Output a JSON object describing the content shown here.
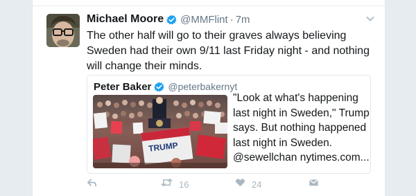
{
  "tweet": {
    "author_name": "Michael Moore",
    "author_handle": "@MMFlint",
    "separator": "·",
    "time": "7m",
    "text": "The other half will go to their graves always believing Sweden had their own 9/11 last Friday night - and nothing will change their minds."
  },
  "quote": {
    "author_name": "Peter Baker",
    "author_handle": "@peterbakernyt",
    "text_lines": [
      "\"Look at what's happening",
      "last night in Sweden,\" Trump",
      "says. But nothing happened",
      "last night in Sweden.",
      "@sewellchan  nytimes.com..."
    ],
    "photo_sign_text": "TRUMP"
  },
  "actions": {
    "reply_icon": "reply-icon",
    "retweet_icon": "retweet-icon",
    "retweet_count": "16",
    "like_icon": "heart-icon",
    "like_count": "24",
    "dm_icon": "envelope-icon"
  },
  "colors": {
    "verified": "#1da1f2",
    "text": "#14171a",
    "secondary": "#657786",
    "action": "#aab8c2",
    "border": "#e1e8ed",
    "background": "#e6ecf0"
  }
}
